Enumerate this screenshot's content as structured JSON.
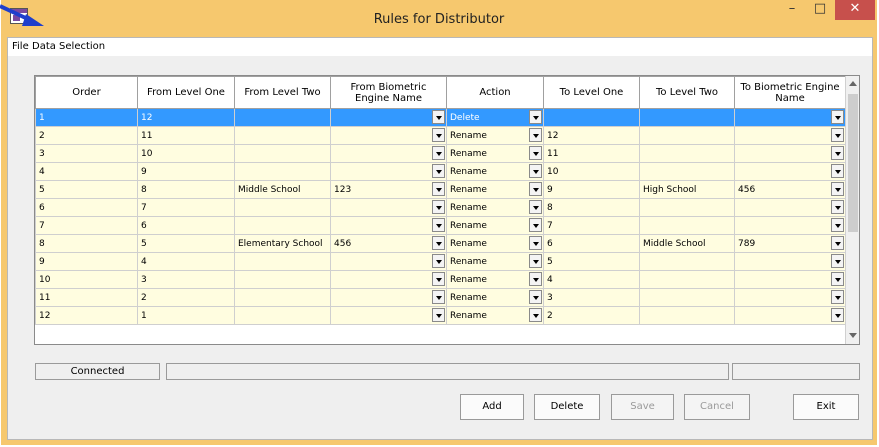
{
  "window": {
    "title": "Rules for Distributor",
    "controls": {
      "minimize": "–",
      "maximize": "□",
      "close": "✕"
    }
  },
  "menu": {
    "file": "File",
    "data_selection": "Data Selection"
  },
  "grid": {
    "columns": [
      "Order",
      "From Level One",
      "From Level Two",
      "From Biometric Engine Name",
      "Action",
      "To Level One",
      "To Level Two",
      "To Biometric Engine Name"
    ],
    "rows": [
      [
        "1",
        "12",
        "",
        "",
        "Delete",
        "",
        "",
        ""
      ],
      [
        "2",
        "11",
        "",
        "",
        "Rename",
        "12",
        "",
        ""
      ],
      [
        "3",
        "10",
        "",
        "",
        "Rename",
        "11",
        "",
        ""
      ],
      [
        "4",
        "9",
        "",
        "",
        "Rename",
        "10",
        "",
        ""
      ],
      [
        "5",
        "8",
        "Middle School",
        "123",
        "Rename",
        "9",
        "High School",
        "456"
      ],
      [
        "6",
        "7",
        "",
        "",
        "Rename",
        "8",
        "",
        ""
      ],
      [
        "7",
        "6",
        "",
        "",
        "Rename",
        "7",
        "",
        ""
      ],
      [
        "8",
        "5",
        "Elementary School",
        "456",
        "Rename",
        "6",
        "Middle School",
        "789"
      ],
      [
        "9",
        "4",
        "",
        "",
        "Rename",
        "5",
        "",
        ""
      ],
      [
        "10",
        "3",
        "",
        "",
        "Rename",
        "4",
        "",
        ""
      ],
      [
        "11",
        "2",
        "",
        "",
        "Rename",
        "3",
        "",
        ""
      ],
      [
        "12",
        "1",
        "",
        "",
        "Rename",
        "2",
        "",
        ""
      ]
    ],
    "selected_row": 0
  },
  "status": {
    "connection": "Connected"
  },
  "buttons": {
    "add": "Add",
    "delete": "Delete",
    "save": "Save",
    "cancel": "Cancel",
    "exit": "Exit"
  },
  "colors": {
    "title_bar": "#f6c86e",
    "close_button": "#c7504c",
    "row_background": "#fffde0",
    "selection": "#3399ff",
    "pointer_arrow": "#1f3fcc"
  },
  "icons": {
    "app": "app-window-icon",
    "pointer": "pointer-arrow-icon",
    "dropdown": "chevron-down-icon"
  }
}
